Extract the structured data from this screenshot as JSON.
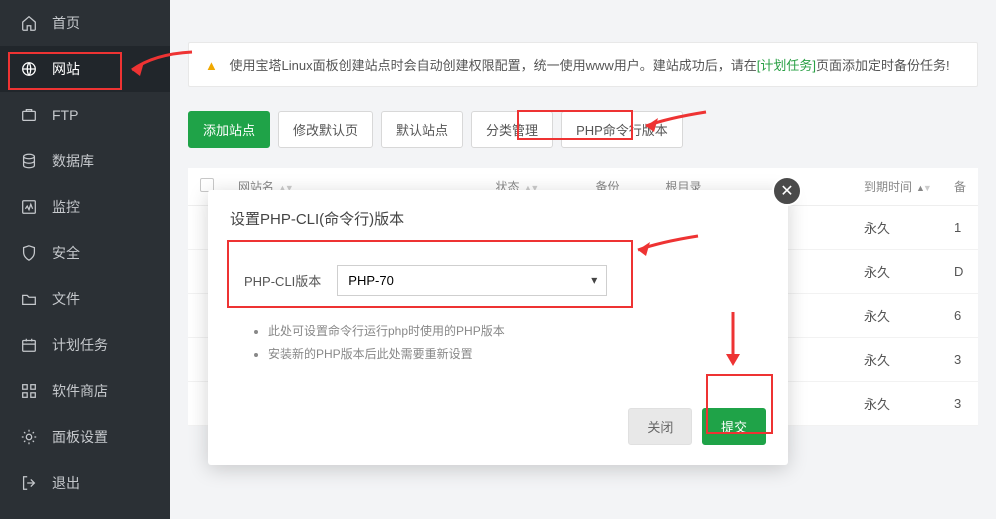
{
  "sidebar": {
    "items": [
      {
        "label": "首页",
        "icon": "home"
      },
      {
        "label": "网站",
        "icon": "globe",
        "active": true
      },
      {
        "label": "FTP",
        "icon": "ftp"
      },
      {
        "label": "数据库",
        "icon": "db"
      },
      {
        "label": "监控",
        "icon": "monitor"
      },
      {
        "label": "安全",
        "icon": "shield"
      },
      {
        "label": "文件",
        "icon": "folder"
      },
      {
        "label": "计划任务",
        "icon": "calendar"
      },
      {
        "label": "软件商店",
        "icon": "grid"
      },
      {
        "label": "面板设置",
        "icon": "gear"
      },
      {
        "label": "退出",
        "icon": "exit"
      }
    ]
  },
  "notice": {
    "text_a": "使用宝塔Linux面板创建站点时会自动创建权限配置，统一使用www用户。建站成功后，请在",
    "link": "[计划任务]",
    "text_b": "页面添加定时备份任务!"
  },
  "toolbar": {
    "add": "添加站点",
    "modify": "修改默认页",
    "default_site": "默认站点",
    "category": "分类管理",
    "php_cli": "PHP命令行版本"
  },
  "table": {
    "headers": {
      "site_name": "网站名",
      "status": "状态",
      "backup": "备份",
      "root": "根目录",
      "expire": "到期时间",
      "remark": "备"
    },
    "rows": [
      {
        "perm": "永久",
        "num": "1"
      },
      {
        "perm": "永久",
        "num": "D"
      },
      {
        "perm": "永久",
        "num": "6"
      },
      {
        "perm": "永久",
        "num": "3"
      },
      {
        "perm": "永久",
        "num": "3"
      }
    ]
  },
  "modal": {
    "title": "设置PHP-CLI(命令行)版本",
    "label": "PHP-CLI版本",
    "selected": "PHP-70",
    "hint1": "此处可设置命令行运行php时使用的PHP版本",
    "hint2": "安装新的PHP版本后此处需要重新设置",
    "close_btn": "关闭",
    "submit_btn": "提交"
  }
}
